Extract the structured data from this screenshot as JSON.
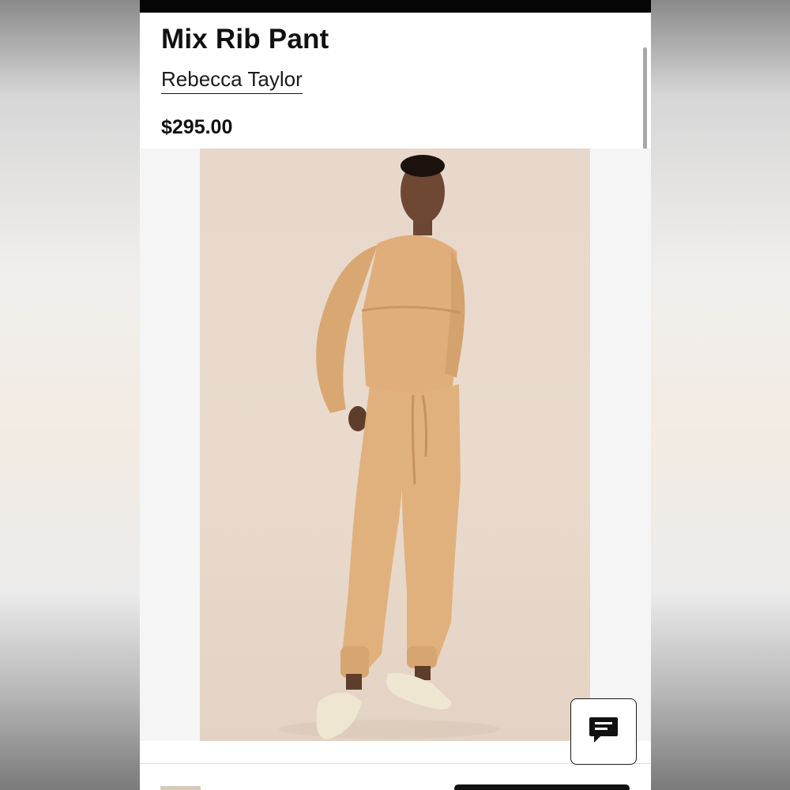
{
  "product": {
    "title": "Mix Rib Pant",
    "brand": "Rebecca Taylor",
    "price": "$295.00"
  },
  "gallery": {
    "image_subject": "model-wearing-camel-knit-set",
    "colors": {
      "backdrop": "#e7d8cb",
      "garment": "#e0b27e",
      "shoes": "#efe6d2"
    }
  },
  "chat": {
    "icon": "chat-icon"
  },
  "colors": {
    "accent": "#111111",
    "page_bg": "#ffffff"
  }
}
